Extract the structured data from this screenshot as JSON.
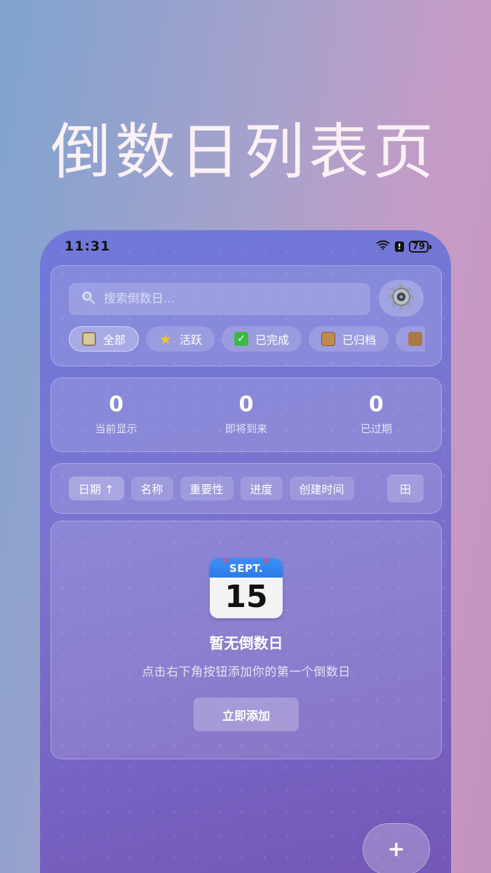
{
  "headline": "倒数日列表页",
  "status_bar": {
    "time": "11:31",
    "wifi": "6",
    "battery": "79"
  },
  "search": {
    "placeholder": "搜索倒数日..."
  },
  "filters": [
    {
      "label": "全部",
      "icon": "clipboard-icon",
      "active": true
    },
    {
      "label": "活跃",
      "icon": "star-icon",
      "active": false
    },
    {
      "label": "已完成",
      "icon": "check-icon",
      "active": false
    },
    {
      "label": "已归档",
      "icon": "box-icon",
      "active": false
    }
  ],
  "stats": [
    {
      "value": "0",
      "label": "当前显示"
    },
    {
      "value": "0",
      "label": "即将到来"
    },
    {
      "value": "0",
      "label": "已过期"
    }
  ],
  "sort": {
    "options": [
      "日期 ↑",
      "名称",
      "重要性",
      "进度",
      "创建时间"
    ],
    "view_toggle": "田"
  },
  "empty": {
    "calendar_month": "SEPT.",
    "calendar_day": "15",
    "title": "暂无倒数日",
    "subtitle": "点击右下角按钮添加你的第一个倒数日",
    "action_label": "立即添加"
  },
  "fab_label": "+",
  "colors": {
    "accent": "#7a74d0",
    "calendar_blue": "#2a7be8"
  }
}
